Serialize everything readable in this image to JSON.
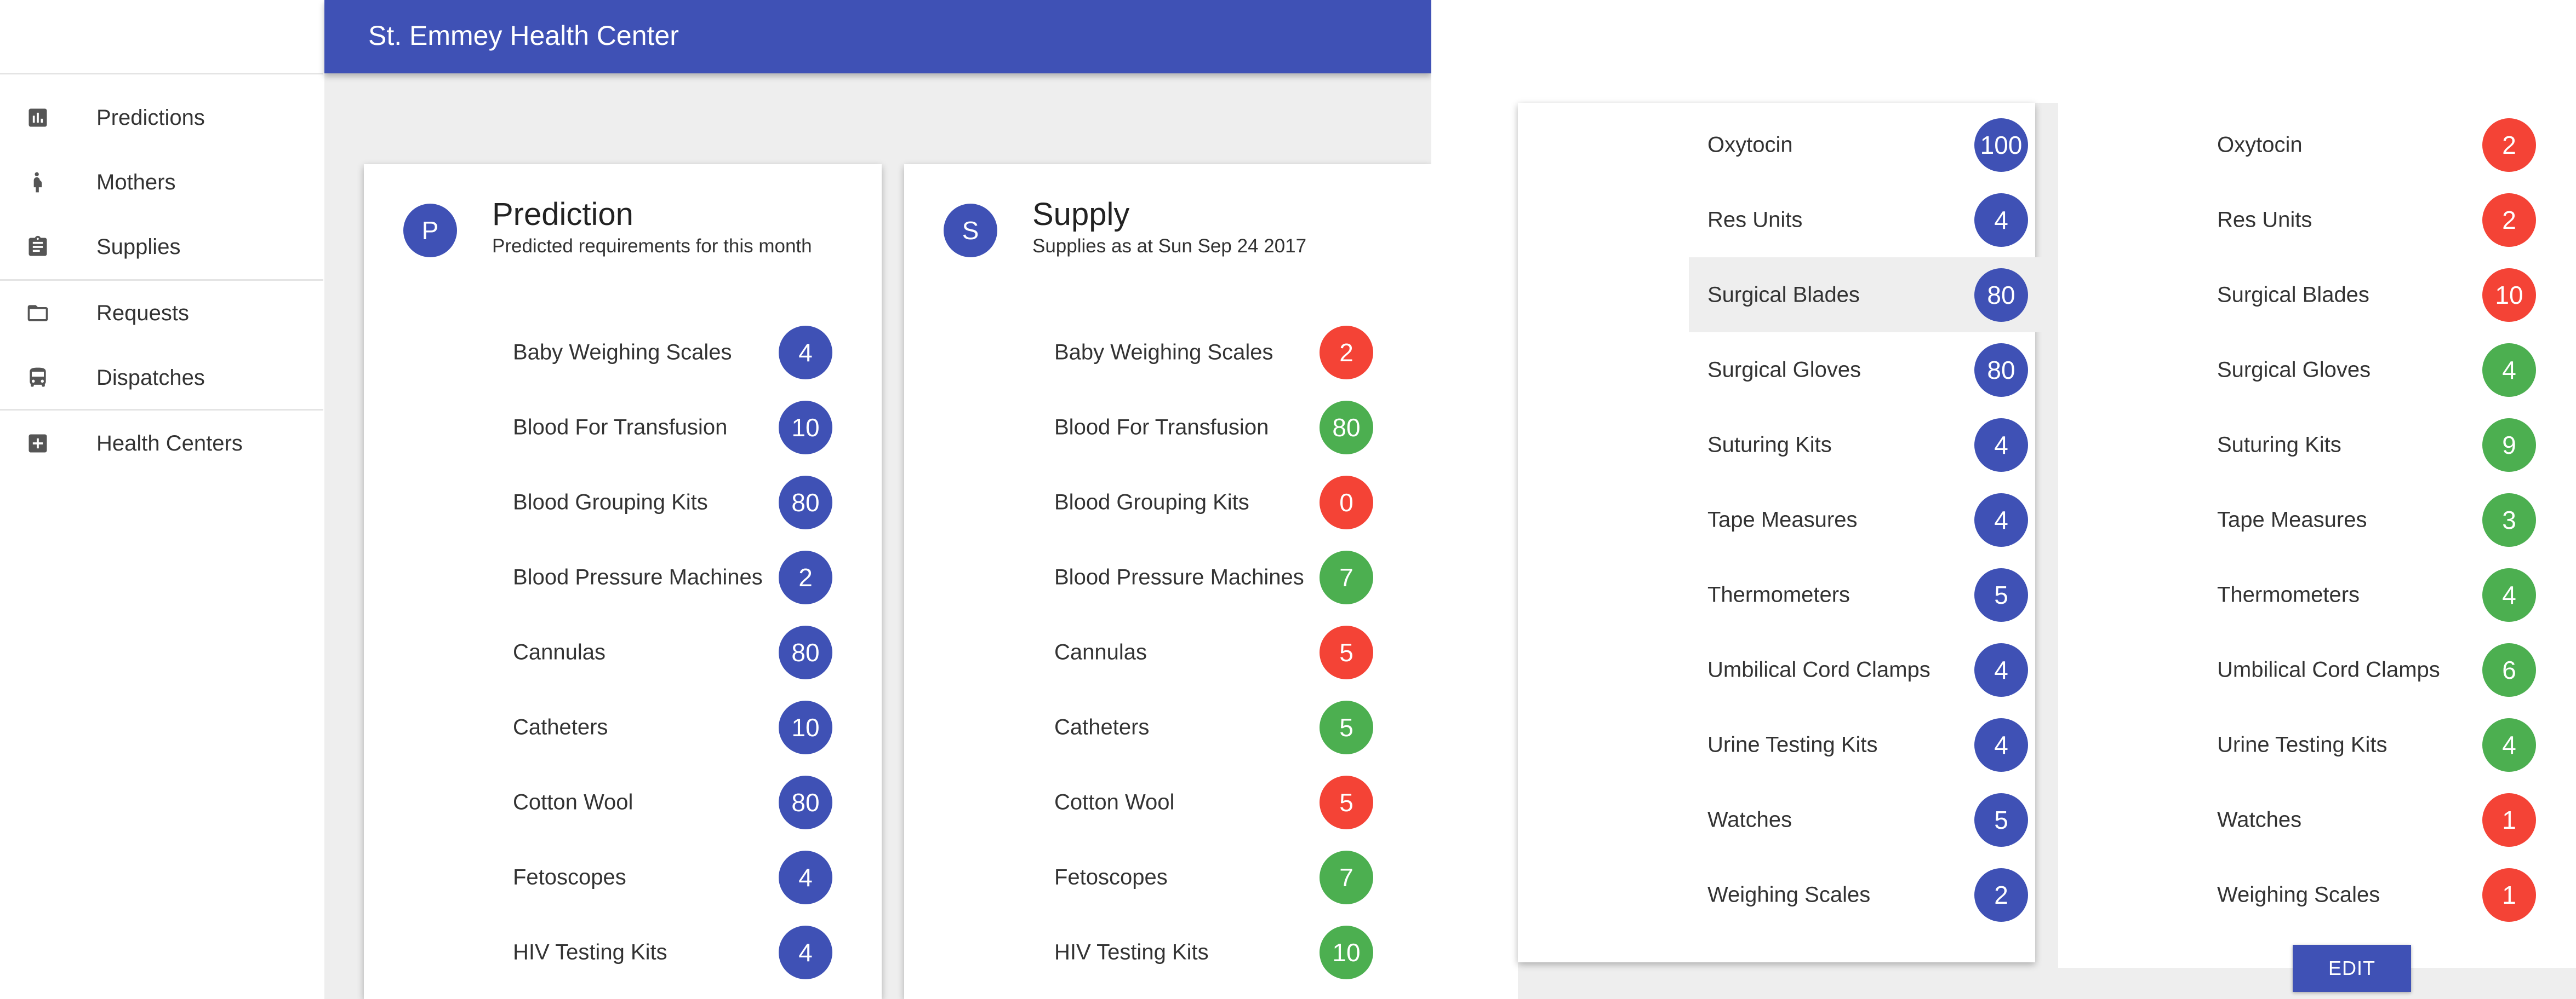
{
  "left": {
    "app_title": "St. Emmey Health Center",
    "nav": [
      {
        "label": "Predictions",
        "icon": "bar-chart-icon"
      },
      {
        "label": "Mothers",
        "icon": "pregnant-woman-icon"
      },
      {
        "label": "Supplies",
        "icon": "clipboard-icon"
      },
      {
        "label": "Requests",
        "icon": "folder-icon"
      },
      {
        "label": "Dispatches",
        "icon": "bus-icon"
      },
      {
        "label": "Health Centers",
        "icon": "add-box-icon"
      }
    ],
    "prediction_card": {
      "avatar": "P",
      "title": "Prediction",
      "subtitle": "Predicted requirements for this month",
      "items": [
        {
          "label": "Baby Weighing Scales",
          "value": "4"
        },
        {
          "label": "Blood For Transfusion",
          "value": "10"
        },
        {
          "label": "Blood Grouping Kits",
          "value": "80"
        },
        {
          "label": "Blood Pressure Machines",
          "value": "2"
        },
        {
          "label": "Cannulas",
          "value": "80"
        },
        {
          "label": "Catheters",
          "value": "10"
        },
        {
          "label": "Cotton Wool",
          "value": "80"
        },
        {
          "label": "Fetoscopes",
          "value": "4"
        },
        {
          "label": "HIV Testing Kits",
          "value": "4"
        }
      ]
    },
    "supply_card": {
      "avatar": "S",
      "title": "Supply",
      "subtitle": "Supplies as at Sun Sep 24 2017",
      "items": [
        {
          "label": "Baby Weighing Scales",
          "value": "2",
          "status": "red"
        },
        {
          "label": "Blood For Transfusion",
          "value": "80",
          "status": "green"
        },
        {
          "label": "Blood Grouping Kits",
          "value": "0",
          "status": "red"
        },
        {
          "label": "Blood Pressure Machines",
          "value": "7",
          "status": "green"
        },
        {
          "label": "Cannulas",
          "value": "5",
          "status": "red"
        },
        {
          "label": "Catheters",
          "value": "5",
          "status": "green"
        },
        {
          "label": "Cotton Wool",
          "value": "5",
          "status": "red"
        },
        {
          "label": "Fetoscopes",
          "value": "7",
          "status": "green"
        },
        {
          "label": "HIV Testing Kits",
          "value": "10",
          "status": "green"
        }
      ]
    }
  },
  "right": {
    "prediction_items": [
      {
        "label": "Oxytocin",
        "value": "100"
      },
      {
        "label": "Res Units",
        "value": "4"
      },
      {
        "label": "Surgical Blades",
        "value": "80",
        "highlighted": true
      },
      {
        "label": "Surgical Gloves",
        "value": "80"
      },
      {
        "label": "Suturing Kits",
        "value": "4"
      },
      {
        "label": "Tape Measures",
        "value": "4"
      },
      {
        "label": "Thermometers",
        "value": "5"
      },
      {
        "label": "Umbilical Cord Clamps",
        "value": "4"
      },
      {
        "label": "Urine Testing Kits",
        "value": "4"
      },
      {
        "label": "Watches",
        "value": "5"
      },
      {
        "label": "Weighing Scales",
        "value": "2"
      }
    ],
    "supply_items": [
      {
        "label": "Oxytocin",
        "value": "2",
        "status": "red"
      },
      {
        "label": "Res Units",
        "value": "2",
        "status": "red"
      },
      {
        "label": "Surgical Blades",
        "value": "10",
        "status": "red"
      },
      {
        "label": "Surgical Gloves",
        "value": "4",
        "status": "green"
      },
      {
        "label": "Suturing Kits",
        "value": "9",
        "status": "green"
      },
      {
        "label": "Tape Measures",
        "value": "3",
        "status": "green"
      },
      {
        "label": "Thermometers",
        "value": "4",
        "status": "green"
      },
      {
        "label": "Umbilical Cord Clamps",
        "value": "6",
        "status": "green"
      },
      {
        "label": "Urine Testing Kits",
        "value": "4",
        "status": "green"
      },
      {
        "label": "Watches",
        "value": "1",
        "status": "red"
      },
      {
        "label": "Weighing Scales",
        "value": "1",
        "status": "red"
      }
    ],
    "edit_label": "EDIT"
  },
  "colors": {
    "primary": "#3f51b5",
    "shortage": "#f44336",
    "sufficient": "#4caf50"
  }
}
